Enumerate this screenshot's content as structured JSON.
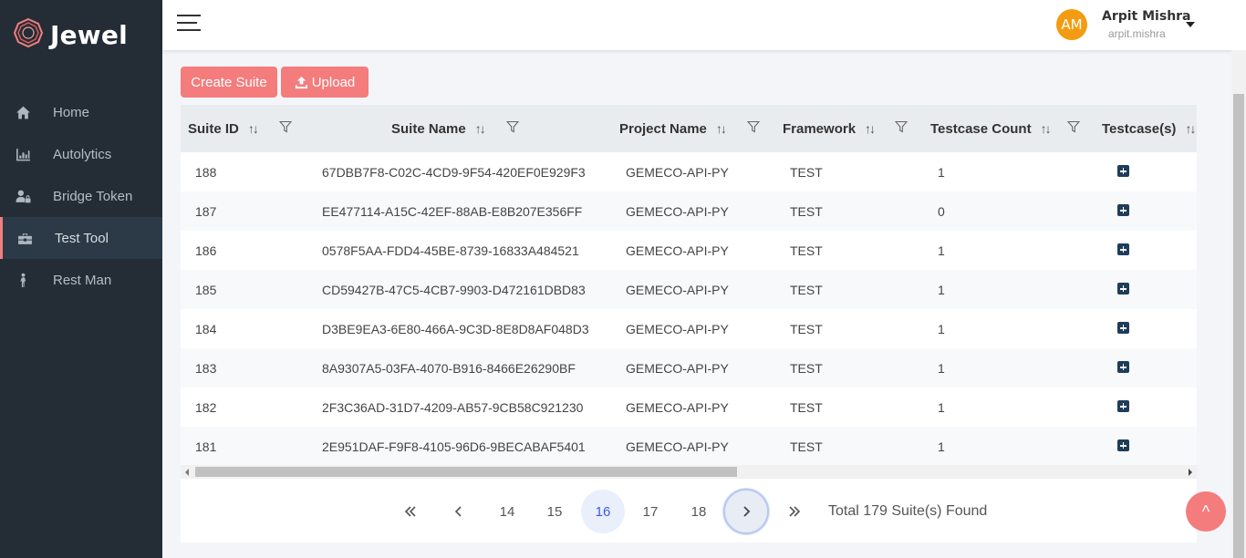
{
  "app": {
    "name": "Jewel"
  },
  "sidebar": {
    "items": [
      {
        "label": "Home",
        "icon": "home-icon",
        "active": false
      },
      {
        "label": "Autolytics",
        "icon": "bar-chart-icon",
        "active": false
      },
      {
        "label": "Bridge Token",
        "icon": "user-lock-icon",
        "active": false
      },
      {
        "label": "Test Tool",
        "icon": "toolbox-icon",
        "active": true
      },
      {
        "label": "Rest Man",
        "icon": "person-walking-icon",
        "active": false
      }
    ]
  },
  "header": {
    "avatar_initials": "AM",
    "user_name": "Arpit Mishra",
    "user_handle": "arpit.mishra"
  },
  "toolbar": {
    "create_label": "Create Suite",
    "upload_label": "Upload"
  },
  "table": {
    "columns": [
      "Suite ID",
      "Suite Name",
      "Project Name",
      "Framework",
      "Testcase Count",
      "Testcase(s)"
    ],
    "sort_glyph": "↑↓",
    "rows": [
      {
        "id": "188",
        "name": "67DBB7F8-C02C-4CD9-9F54-420EF0E929F3",
        "project": "GEMECO-API-PY",
        "framework": "TEST",
        "count": "1"
      },
      {
        "id": "187",
        "name": "EE477114-A15C-42EF-88AB-E8B207E356FF",
        "project": "GEMECO-API-PY",
        "framework": "TEST",
        "count": "0"
      },
      {
        "id": "186",
        "name": "0578F5AA-FDD4-45BE-8739-16833A484521",
        "project": "GEMECO-API-PY",
        "framework": "TEST",
        "count": "1"
      },
      {
        "id": "185",
        "name": "CD59427B-47C5-4CB7-9903-D472161DBD83",
        "project": "GEMECO-API-PY",
        "framework": "TEST",
        "count": "1"
      },
      {
        "id": "184",
        "name": "D3BE9EA3-6E80-466A-9C3D-8E8D8AF048D3",
        "project": "GEMECO-API-PY",
        "framework": "TEST",
        "count": "1"
      },
      {
        "id": "183",
        "name": "8A9307A5-03FA-4070-B916-8466E26290BF",
        "project": "GEMECO-API-PY",
        "framework": "TEST",
        "count": "1"
      },
      {
        "id": "182",
        "name": "2F3C36AD-31D7-4209-AB57-9CB58C921230",
        "project": "GEMECO-API-PY",
        "framework": "TEST",
        "count": "1"
      },
      {
        "id": "181",
        "name": "2E951DAF-F9F8-4105-96D6-9BECABAF5401",
        "project": "GEMECO-API-PY",
        "framework": "TEST",
        "count": "1"
      }
    ]
  },
  "pagination": {
    "pages": [
      "14",
      "15",
      "16",
      "17",
      "18"
    ],
    "current": "16",
    "total_text": "Total 179 Suite(s) Found"
  },
  "scroll_top_label": "^",
  "colors": {
    "accent": "#f47c7c",
    "sidebar": "#242d35",
    "avatar": "#f39c12"
  }
}
